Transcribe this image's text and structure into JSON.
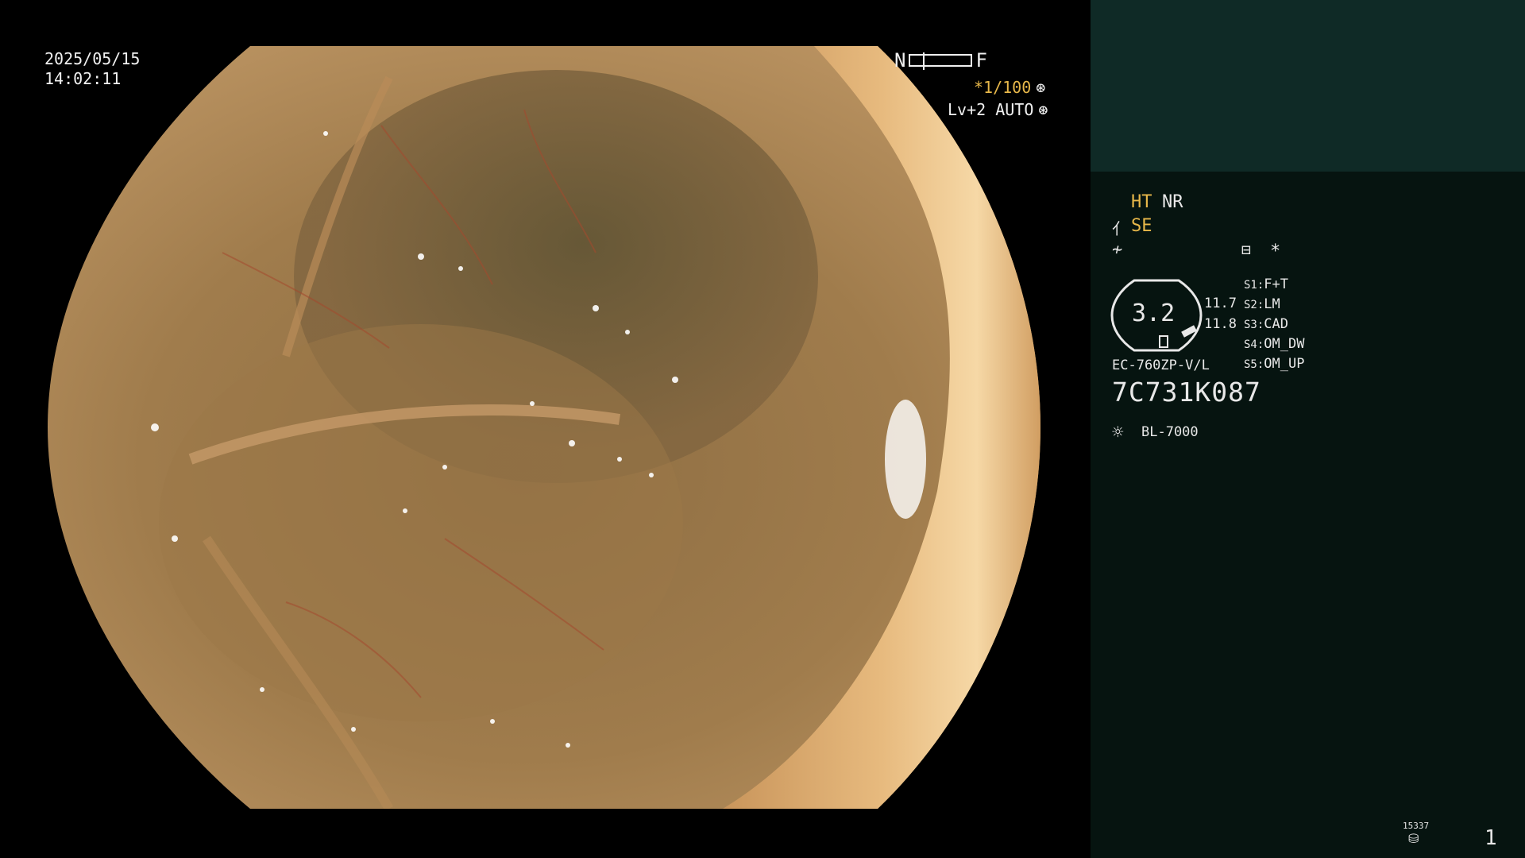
{
  "overlay": {
    "date": "2025/05/15",
    "time": "14:02:11",
    "near_label": "N",
    "far_label": "F",
    "shutter": "*1/100",
    "iris": "Lv+2 AUTO"
  },
  "panel": {
    "modes": {
      "ht": "HT",
      "nr": "NR",
      "se": "SE"
    },
    "gauge_value": "3.2",
    "readout_1": "11.7",
    "readout_2": "11.8",
    "star": "*",
    "scope_model": "EC-760ZP-V/L",
    "serial": "7C731K087",
    "light_source": "BL-7000",
    "switches": [
      {
        "key": "S1:",
        "value": "F+T"
      },
      {
        "key": "S2:",
        "value": "LM"
      },
      {
        "key": "S3:",
        "value": "CAD"
      },
      {
        "key": "S4:",
        "value": "OM_DW"
      },
      {
        "key": "S5:",
        "value": "OM_UP"
      }
    ],
    "storage_count": "15337",
    "page_number": "1"
  },
  "colors": {
    "accent_yellow": "#e8b84a",
    "panel_bg": "#061410",
    "panel_top": "#0f2a26"
  },
  "icons": [
    "shutter-icon",
    "iris-icon",
    "structure-enhance-icon",
    "color-enhance-icon",
    "memo-icon",
    "light-icon",
    "storage-icon"
  ]
}
